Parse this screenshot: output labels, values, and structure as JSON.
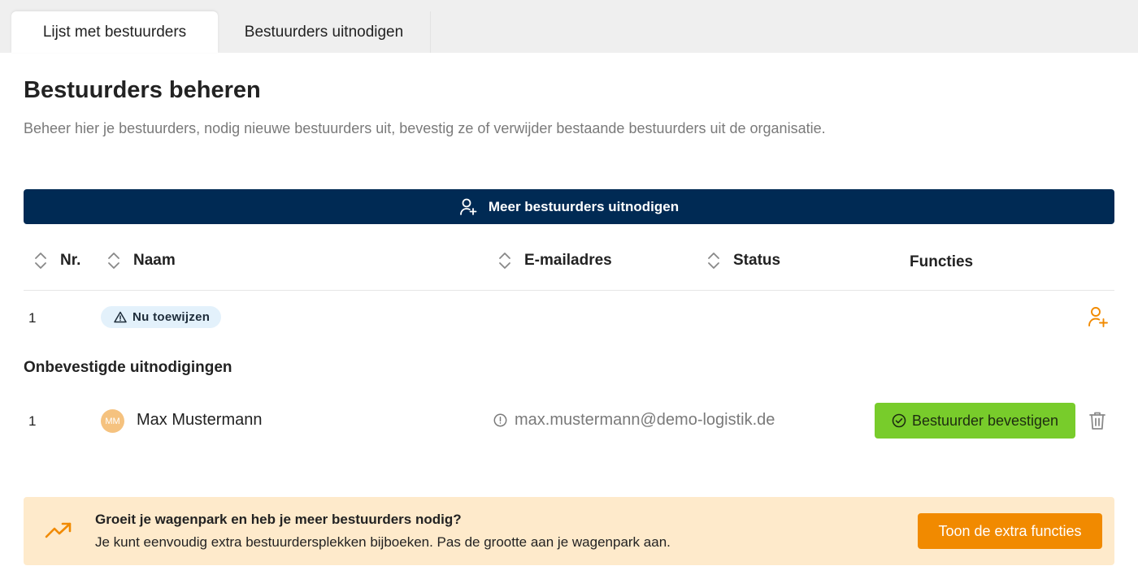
{
  "tabs": [
    {
      "label": "Lijst met bestuurders",
      "active": true
    },
    {
      "label": "Bestuurders uitnodigen",
      "active": false
    }
  ],
  "page": {
    "title": "Bestuurders beheren",
    "description": "Beheer hier je bestuurders, nodig nieuwe bestuurders uit, bevestig ze of verwijder bestaande bestuurders uit de organisatie."
  },
  "invite_button": {
    "label": "Meer bestuurders uitnodigen",
    "icon": "user-plus-icon"
  },
  "table": {
    "columns": [
      {
        "label": "Nr.",
        "sortable": true
      },
      {
        "label": "Naam",
        "sortable": true
      },
      {
        "label": "E-mailadres",
        "sortable": true
      },
      {
        "label": "Status",
        "sortable": true
      },
      {
        "label": "Functies",
        "sortable": false
      }
    ],
    "rows": [
      {
        "nr": "1",
        "badge": "Nu toewijzen"
      }
    ]
  },
  "unconfirmed": {
    "title": "Onbevestigde uitnodigingen",
    "rows": [
      {
        "nr": "1",
        "initials": "MM",
        "name": "Max Mustermann",
        "email": "max.mustermann@demo-logistik.de",
        "confirm_label": "Bestuurder bevestigen"
      }
    ]
  },
  "banner": {
    "title": "Groeit je wagenpark en heb je meer bestuurders nodig?",
    "text": "Je kunt eenvoudig extra bestuurdersplekken bijboeken. Pas de grootte aan je wagenpark aan.",
    "button_label": "Toon de extra functies"
  },
  "colors": {
    "primary_navy": "#002a54",
    "success_green": "#78cc2b",
    "accent_orange": "#f18a00",
    "banner_bg": "#feeacb",
    "badge_bg": "#e3f1fb"
  }
}
